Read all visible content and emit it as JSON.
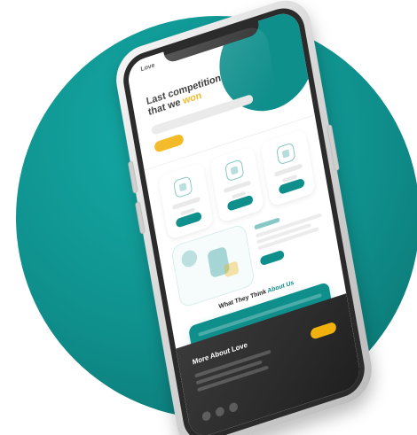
{
  "screen": {
    "logo_text": "Love",
    "hero": {
      "title_line1": "Last competition",
      "title_line2_prefix": "that we ",
      "title_accent": "won"
    },
    "testimonials": {
      "title_prefix": "What They Think ",
      "title_accent": "About Us"
    },
    "footer": {
      "title": "More About Love"
    }
  },
  "colors": {
    "teal": "#0f8f8c",
    "accent_yellow": "#f2b20e",
    "footer_dark": "#2c2c2c"
  }
}
